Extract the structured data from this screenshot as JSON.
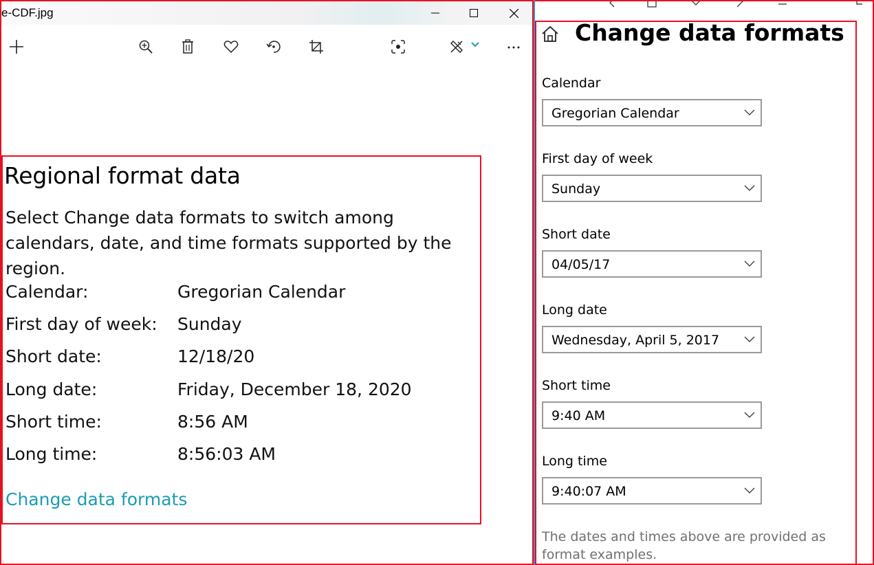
{
  "window": {
    "title": "e-CDF.jpg",
    "colors": {
      "highlight_border": "#e81123",
      "link": "#1a9cb5",
      "divider": "#3b8fd6"
    }
  },
  "toolbar": {
    "icons": [
      "add-icon",
      "zoom-in-icon",
      "delete-icon",
      "favorite-icon",
      "rotate-icon",
      "crop-icon",
      "visual-search-icon",
      "edit-draw-icon",
      "chevron-down-icon",
      "more-icon"
    ]
  },
  "regional": {
    "title": "Regional format data",
    "description": "Select Change data formats to switch among calendars, date, and time formats supported by the region.",
    "rows": [
      {
        "label": "Calendar:",
        "value": "Gregorian Calendar"
      },
      {
        "label": "First day of week:",
        "value": "Sunday"
      },
      {
        "label": "Short date:",
        "value": "12/18/20"
      },
      {
        "label": "Long date:",
        "value": "Friday, December 18, 2020"
      },
      {
        "label": "Short time:",
        "value": "8:56 AM"
      },
      {
        "label": "Long time:",
        "value": "8:56:03 AM"
      }
    ],
    "link": "Change data formats"
  },
  "change_formats": {
    "title": "Change data formats",
    "fields": [
      {
        "label": "Calendar",
        "value": "Gregorian Calendar"
      },
      {
        "label": "First day of week",
        "value": "Sunday"
      },
      {
        "label": "Short date",
        "value": "04/05/17"
      },
      {
        "label": "Long date",
        "value": "Wednesday, April 5, 2017"
      },
      {
        "label": "Short time",
        "value": "9:40 AM"
      },
      {
        "label": "Long time",
        "value": "9:40:07 AM"
      }
    ],
    "footnote": "The dates and times above are provided as format examples."
  }
}
